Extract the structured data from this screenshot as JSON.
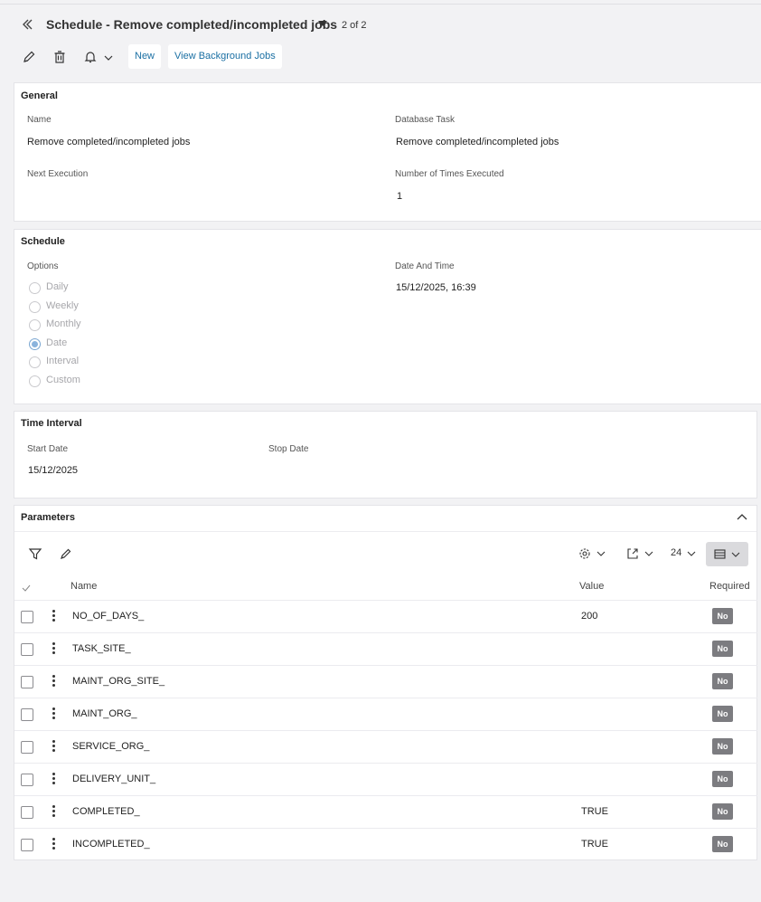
{
  "header": {
    "title": "Schedule - Remove completed/incompleted jobs",
    "pager": "2 of 2"
  },
  "toolbar": {
    "new_label": "New",
    "view_bg_label": "View Background Jobs"
  },
  "general": {
    "title": "General",
    "name_label": "Name",
    "name_value": "Remove completed/incompleted jobs",
    "db_task_label": "Database Task",
    "db_task_value": "Remove completed/incompleted jobs",
    "next_exec_label": "Next Execution",
    "next_exec_value": "",
    "times_executed_label": "Number of Times Executed",
    "times_executed_value": "1"
  },
  "schedule": {
    "title": "Schedule",
    "options_label": "Options",
    "options": [
      {
        "label": "Daily",
        "selected": false
      },
      {
        "label": "Weekly",
        "selected": false
      },
      {
        "label": "Monthly",
        "selected": false
      },
      {
        "label": "Date",
        "selected": true
      },
      {
        "label": "Interval",
        "selected": false
      },
      {
        "label": "Custom",
        "selected": false
      }
    ],
    "datetime_label": "Date And Time",
    "datetime_value": "15/12/2025, 16:39"
  },
  "time_interval": {
    "title": "Time Interval",
    "start_label": "Start Date",
    "start_value": "15/12/2025",
    "stop_label": "Stop Date",
    "stop_value": ""
  },
  "parameters": {
    "title": "Parameters",
    "page_size": "24",
    "columns": {
      "name": "Name",
      "value": "Value",
      "required": "Required"
    },
    "rows": [
      {
        "name": "NO_OF_DAYS_",
        "value": "200",
        "required": "No"
      },
      {
        "name": "TASK_SITE_",
        "value": "",
        "required": "No"
      },
      {
        "name": "MAINT_ORG_SITE_",
        "value": "",
        "required": "No"
      },
      {
        "name": "MAINT_ORG_",
        "value": "",
        "required": "No"
      },
      {
        "name": "SERVICE_ORG_",
        "value": "",
        "required": "No"
      },
      {
        "name": "DELIVERY_UNIT_",
        "value": "",
        "required": "No"
      },
      {
        "name": "COMPLETED_",
        "value": "TRUE",
        "required": "No"
      },
      {
        "name": "INCOMPLETED_",
        "value": "TRUE",
        "required": "No"
      }
    ]
  },
  "colors": {
    "link": "#1a6fa3",
    "badge": "#7c7c80",
    "radio_selected": "#8ab3dc"
  }
}
